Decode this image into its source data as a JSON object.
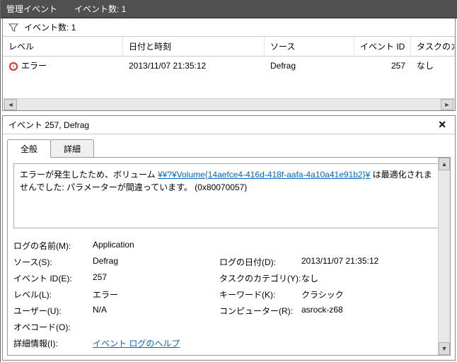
{
  "titlebar": {
    "title": "管理イベント",
    "count_label": "イベント数: 1"
  },
  "filter": {
    "count_label": "イベント数: 1"
  },
  "columns": {
    "level": "レベル",
    "datetime": "日付と時刻",
    "source": "ソース",
    "event_id": "イベント ID",
    "task": "タスクのカテ"
  },
  "rows": [
    {
      "level": "エラー",
      "datetime": "2013/11/07 21:35:12",
      "source": "Defrag",
      "event_id": "257",
      "task": "なし"
    }
  ],
  "detail_header": "イベント 257, Defrag",
  "tabs": {
    "general": "全般",
    "details": "詳細"
  },
  "message": {
    "pre": "エラーが発生したため、ボリューム ",
    "link": "¥¥?¥Volume{14aefce4-416d-418f-aafa-4a10a41e91b2}¥",
    "post": " は最適化されませんでした: パラメーターが間違っています。 (0x80070057)"
  },
  "props": {
    "log_name_label": "ログの名前(M):",
    "log_name_value": "Application",
    "source_label": "ソース(S):",
    "source_value": "Defrag",
    "log_date_label": "ログの日付(D):",
    "log_date_value": "2013/11/07 21:35:12",
    "event_id_label": "イベント ID(E):",
    "event_id_value": "257",
    "task_cat_label": "タスクのカテゴリ(Y):",
    "task_cat_value": "なし",
    "level_label": "レベル(L):",
    "level_value": "エラー",
    "keyword_label": "キーワード(K):",
    "keyword_value": "クラシック",
    "user_label": "ユーザー(U):",
    "user_value": "N/A",
    "computer_label": "コンピューター(R):",
    "computer_value": "asrock-z68",
    "opcode_label": "オペコード(O):",
    "opcode_value": "",
    "moreinfo_label": "詳細情報(I):",
    "moreinfo_link": "イベント ログのヘルプ"
  }
}
